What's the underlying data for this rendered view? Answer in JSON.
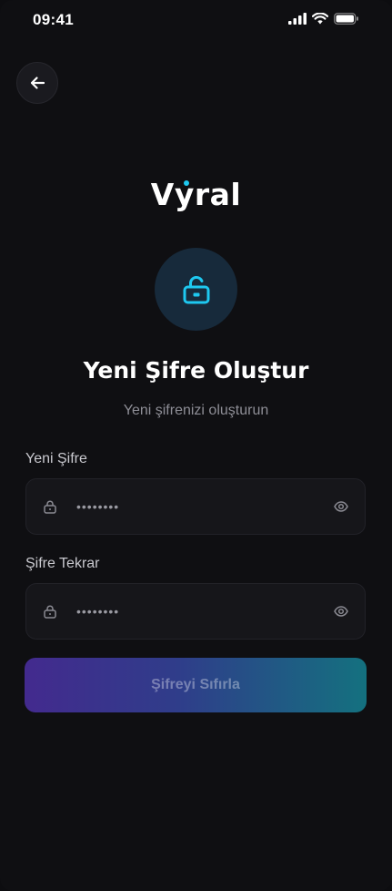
{
  "status_bar": {
    "time": "09:41"
  },
  "icons": {
    "back": "arrow-left-icon",
    "lock_main": "lock-open-icon",
    "field_lock": "lock-icon",
    "visibility": "eye-icon",
    "signal": "signal-icon",
    "wifi": "wifi-icon",
    "battery": "battery-icon"
  },
  "brand": {
    "logo": "Vyral",
    "accent_color": "#1ec8f0"
  },
  "header": {
    "title": "Yeni Şifre Oluştur",
    "subtitle": "Yeni şifrenizi oluşturun"
  },
  "form": {
    "new_password": {
      "label": "Yeni Şifre",
      "value_masked": "••••••••"
    },
    "confirm_password": {
      "label": "Şifre Tekrar",
      "value_masked": "••••••••"
    },
    "submit_label": "Şifreyi Sıfırla"
  },
  "colors": {
    "background": "#0f0f12",
    "field_background": "#16161a",
    "button_gradient_start": "#432a8e",
    "button_gradient_end": "#14717f"
  }
}
